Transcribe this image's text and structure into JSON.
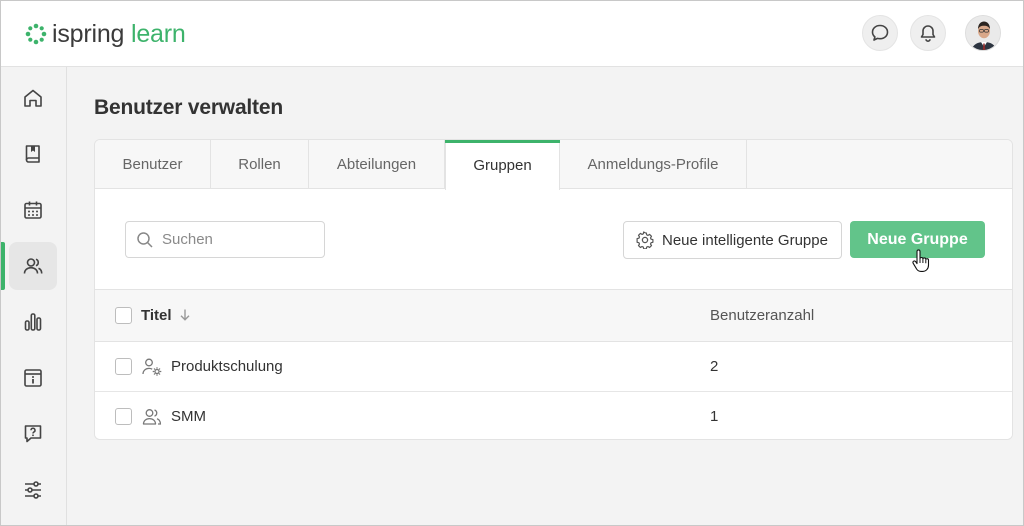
{
  "brand": {
    "word1": "ispring",
    "word2": "learn",
    "accent": "#3db36b"
  },
  "topbar": {
    "icons": [
      "chat-bubble-icon",
      "bell-icon",
      "user-avatar"
    ]
  },
  "sidebar": {
    "items": [
      {
        "icon": "home-icon"
      },
      {
        "icon": "book-icon"
      },
      {
        "icon": "calendar-icon"
      },
      {
        "icon": "users-icon",
        "active": true
      },
      {
        "icon": "bar-chart-icon"
      },
      {
        "icon": "info-calendar-icon"
      },
      {
        "icon": "question-chat-icon"
      },
      {
        "icon": "sliders-icon"
      }
    ]
  },
  "page": {
    "title": "Benutzer verwalten"
  },
  "tabs": [
    {
      "label": "Benutzer"
    },
    {
      "label": "Rollen"
    },
    {
      "label": "Abteilungen"
    },
    {
      "label": "Gruppen",
      "active": true
    },
    {
      "label": "Anmeldungs-Profile"
    }
  ],
  "toolbar": {
    "search_placeholder": "Suchen",
    "smart_group_label": "Neue intelligente Gruppe",
    "new_group_label": "Neue Gruppe"
  },
  "table": {
    "columns": [
      "Titel",
      "Benutzeranzahl"
    ],
    "rows": [
      {
        "icon": "smart-group-icon",
        "title": "Produktschulung",
        "count": "2"
      },
      {
        "icon": "group-icon",
        "title": "SMM",
        "count": "1"
      }
    ]
  }
}
